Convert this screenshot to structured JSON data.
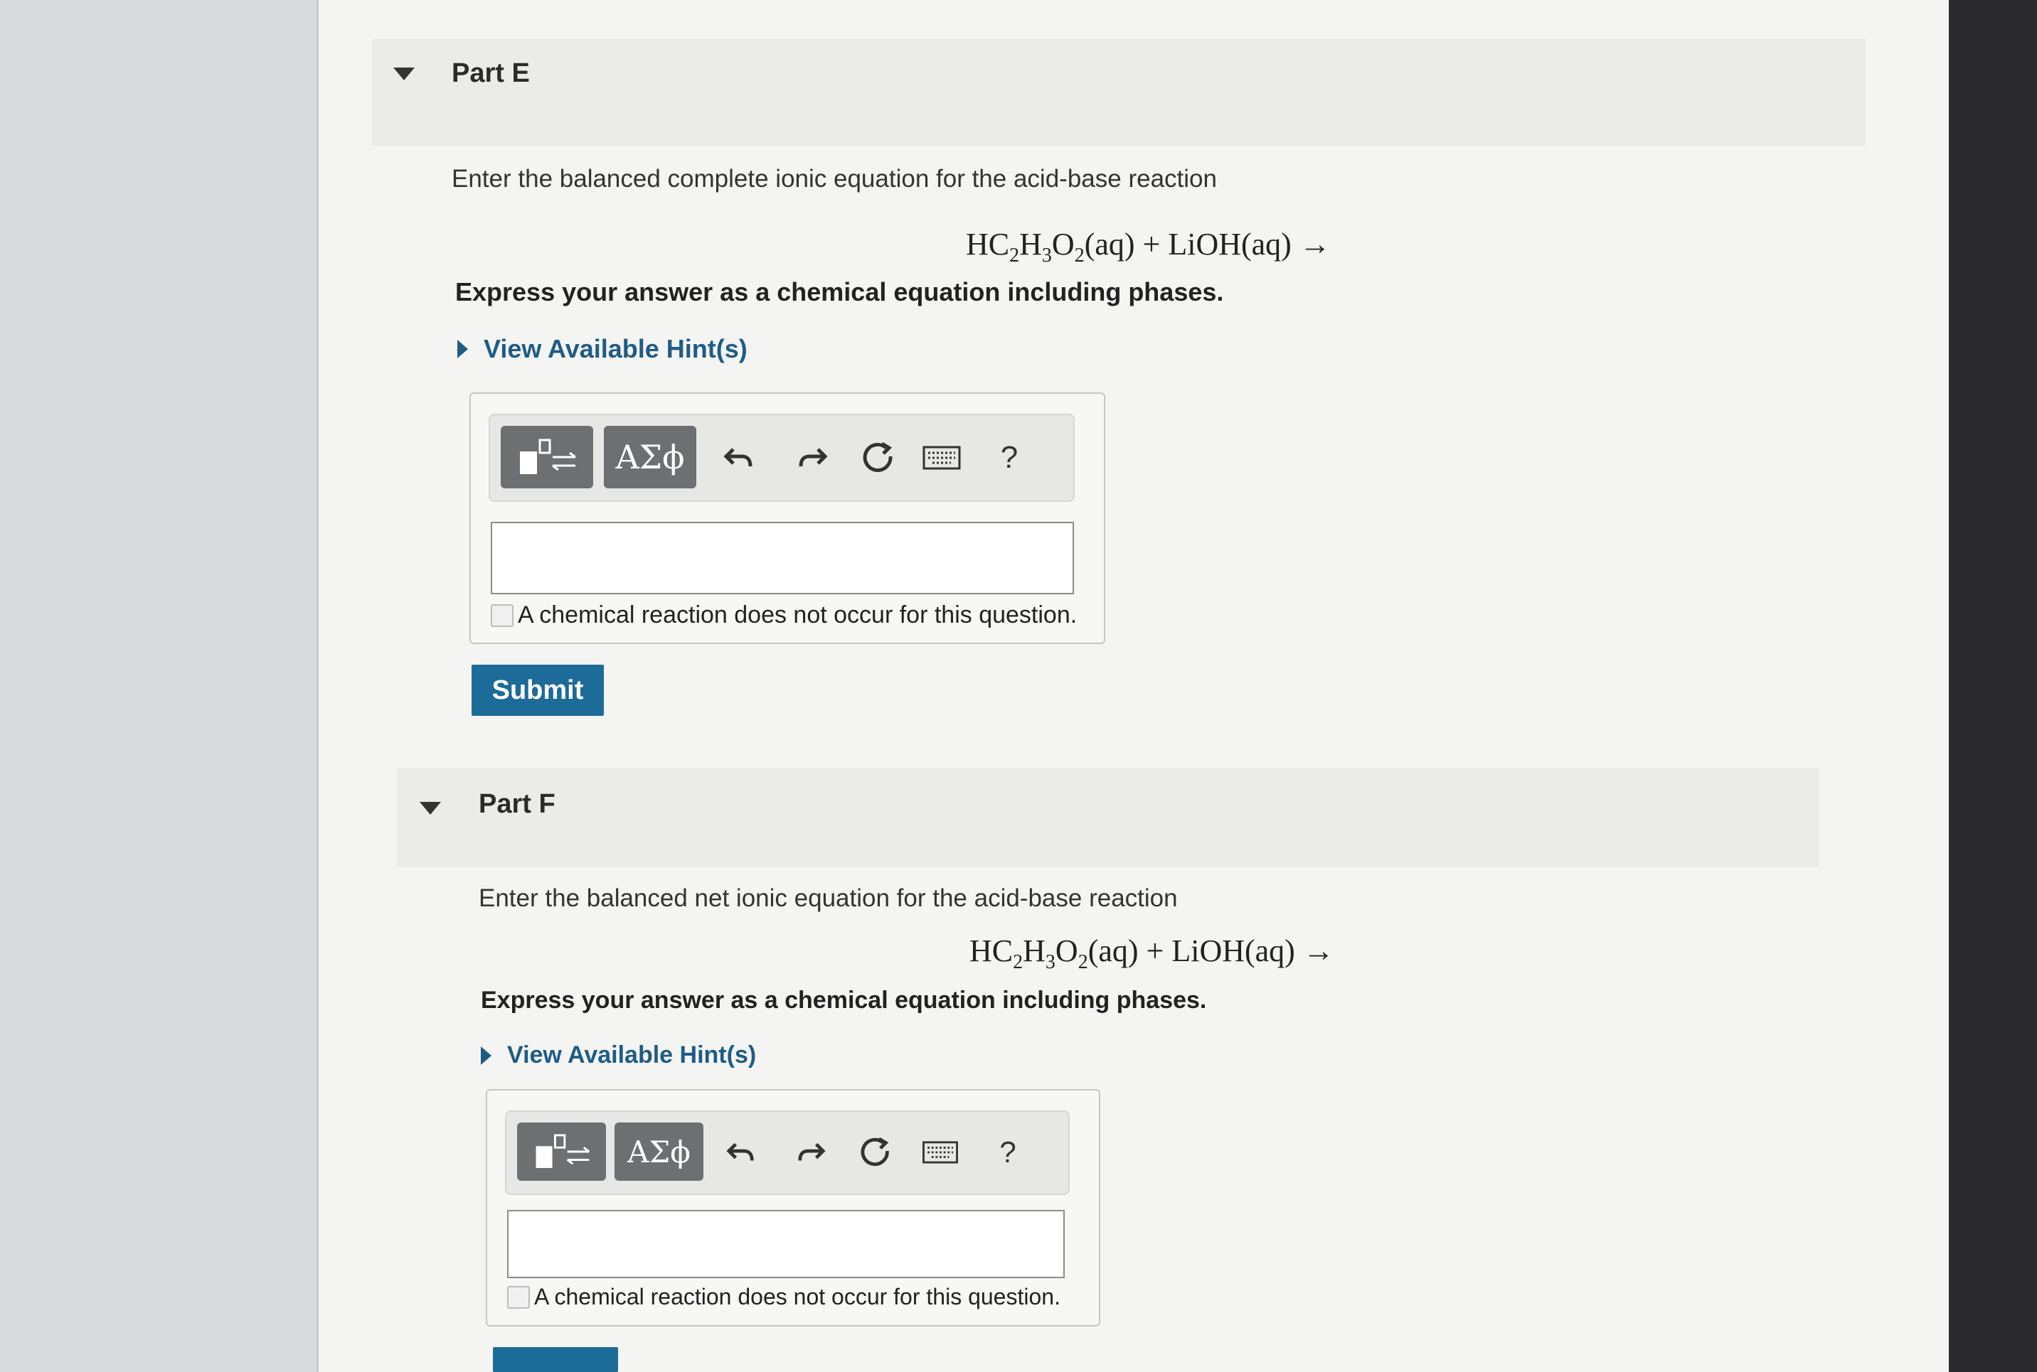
{
  "part_e": {
    "title": "Part E",
    "question": "Enter the balanced complete ionic equation for the acid-base reaction",
    "equation": {
      "main": "HC",
      "s1": "2",
      "h": "H",
      "s2": "3",
      "o": "O",
      "s3": "2",
      "rest": "(aq) + LiOH(aq) →"
    },
    "instruction": "Express your answer as a chemical equation including phases.",
    "hint_label": "View Available Hint(s)",
    "toolbar": {
      "greek_label": "ΑΣϕ",
      "help_label": "?"
    },
    "answer_value": "",
    "no_reaction_label": "A chemical reaction does not occur for this question.",
    "submit_label": "Submit"
  },
  "part_f": {
    "title": "Part F",
    "question": "Enter the balanced net ionic equation for the acid-base reaction",
    "equation": {
      "main": "HC",
      "s1": "2",
      "h": "H",
      "s2": "3",
      "o": "O",
      "s3": "2",
      "rest": "(aq) + LiOH(aq) →"
    },
    "instruction": "Express your answer as a chemical equation including phases.",
    "hint_label": "View Available Hint(s)",
    "toolbar": {
      "greek_label": "ΑΣϕ",
      "help_label": "?"
    },
    "answer_value": "",
    "no_reaction_label": "A chemical reaction does not occur for this question."
  },
  "colors": {
    "accent": "#1d6b99",
    "hint_link": "#1f5c85",
    "toolbar_button": "#6d6f72"
  }
}
